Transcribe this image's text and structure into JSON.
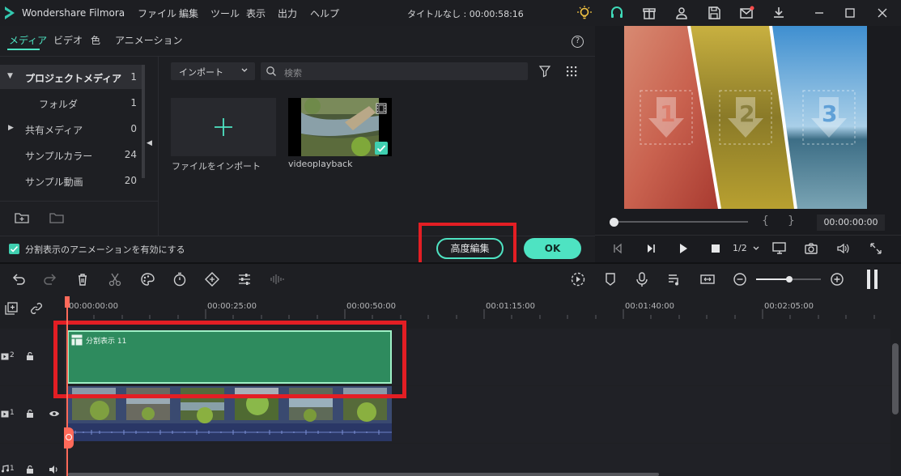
{
  "app": {
    "title": "Wondershare Filmora",
    "project_status": "タイトルなし : 00:00:58:16"
  },
  "menu": [
    "ファイル",
    "編集",
    "ツール",
    "表示",
    "出力",
    "ヘルプ"
  ],
  "media_tabs": [
    "メディア",
    "ビデオ",
    "色",
    "アニメーション"
  ],
  "tree": [
    {
      "label": "プロジェクトメディア",
      "count": "1"
    },
    {
      "label": "フォルダ",
      "count": "1"
    },
    {
      "label": "共有メディア",
      "count": "0"
    },
    {
      "label": "サンプルカラー",
      "count": "24"
    },
    {
      "label": "サンプル動画",
      "count": "20"
    }
  ],
  "import_dropdown": "インポート",
  "search_placeholder": "検索",
  "media_items": {
    "import_label": "ファイルをインポート",
    "video_label": "videoplayback"
  },
  "split_option": "分割表示のアニメーションを有効にする",
  "buttons": {
    "advanced": "高度編集",
    "ok": "OK"
  },
  "preview": {
    "time": "00:00:00:00",
    "braces_open": "{",
    "braces_close": "}",
    "ratio": "1/2",
    "numbers": [
      "1",
      "2",
      "3"
    ]
  },
  "timeline": {
    "ruler": [
      "00:00:00:00",
      "00:00:25:00",
      "00:00:50:00",
      "00:01:15:00",
      "00:01:40:00",
      "00:02:05:00"
    ],
    "track_labels": [
      "2",
      "1",
      "1"
    ],
    "split_clip_label": "分割表示 11"
  },
  "colors": {
    "accent": "#4ee3c2",
    "highlight": "#e31e24",
    "clip_green": "#2e8b5e",
    "playhead": "#ff6a5a"
  }
}
